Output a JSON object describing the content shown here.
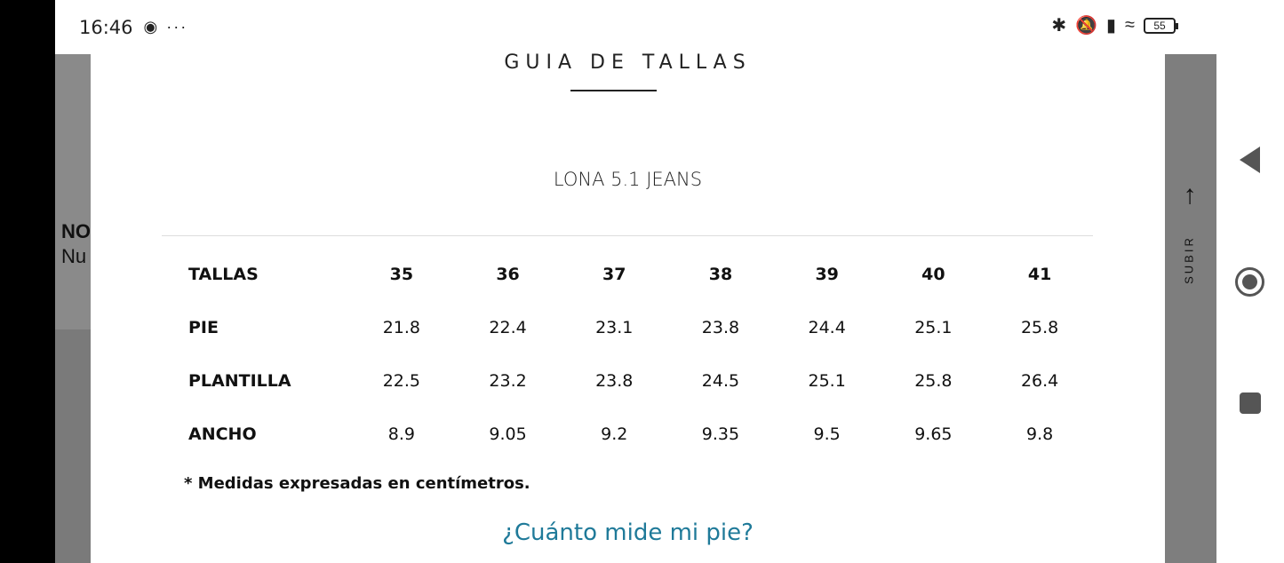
{
  "statusbar": {
    "time": "16:46",
    "battery": "55",
    "icons": [
      "chat-bubble-icon",
      "more-dots-icon",
      "bluetooth-icon",
      "mute-icon",
      "signal-icon",
      "wifi-icon",
      "battery-icon"
    ]
  },
  "background": {
    "heading_fragment": "NO",
    "sub_fragment": "Nu",
    "scroll_top_label": "SUBIR"
  },
  "modal": {
    "title": "GUIA DE TALLAS",
    "product": "LONA 5.1 JEANS",
    "table": {
      "header": {
        "label": "TALLAS",
        "cells": [
          "35",
          "36",
          "37",
          "38",
          "39",
          "40",
          "41"
        ]
      },
      "rows": [
        {
          "label": "PIE",
          "cells": [
            "21.8",
            "22.4",
            "23.1",
            "23.8",
            "24.4",
            "25.1",
            "25.8"
          ]
        },
        {
          "label": "PLANTILLA",
          "cells": [
            "22.5",
            "23.2",
            "23.8",
            "24.5",
            "25.1",
            "25.8",
            "26.4"
          ]
        },
        {
          "label": "ANCHO",
          "cells": [
            "8.9",
            "9.05",
            "9.2",
            "9.35",
            "9.5",
            "9.65",
            "9.8"
          ]
        }
      ]
    },
    "note": "* Medidas expresadas en centímetros.",
    "link": "¿Cuánto mide mi pie?"
  },
  "colors": {
    "link": "#1f7a99",
    "text": "#111111",
    "overlay": "#7a7a7a"
  }
}
